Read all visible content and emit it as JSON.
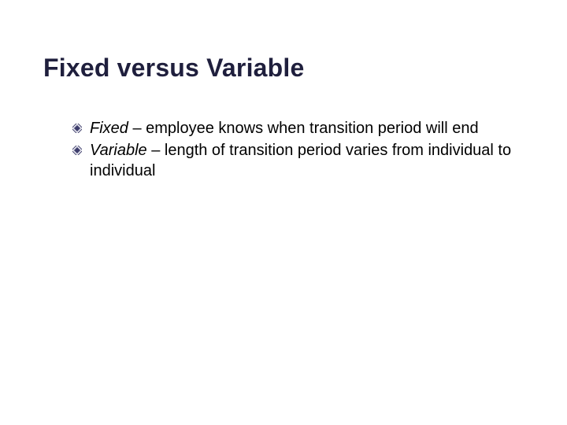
{
  "title": "Fixed versus Variable",
  "bullets": [
    {
      "term": "Fixed",
      "desc": " – employee knows when transition period will end"
    },
    {
      "term": "Variable",
      "desc": " – length of transition period varies from individual to individual"
    }
  ],
  "colors": {
    "bullet_fill": "#3d3d6b",
    "bullet_stroke": "#8a8aa8"
  }
}
